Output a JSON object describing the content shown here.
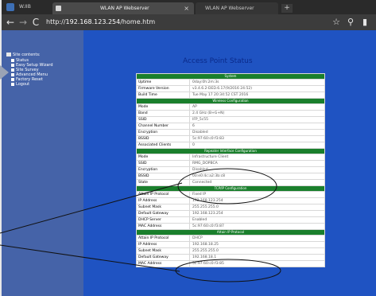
{
  "browser": {
    "app_name": "W.IIB",
    "tabs": [
      {
        "title": "WLAN AP Webserver",
        "active": true
      },
      {
        "title": "WLAN AP Webserver",
        "active": false
      }
    ],
    "url_prefix": "http://",
    "url_host": "192.168.123.254",
    "url_path": "/home.htm",
    "icons": [
      "back-icon",
      "forward-icon",
      "reload-icon",
      "star-icon",
      "search-icon",
      "bookmark-icon",
      "close-icon",
      "new-tab-icon"
    ]
  },
  "sidebar": {
    "title": "Site contents:",
    "items": [
      {
        "label": "Status"
      },
      {
        "label": "Easy Setup Wizard"
      },
      {
        "label": "Site Survey"
      },
      {
        "label": "Advanced Menu"
      },
      {
        "label": "Factory Reset"
      },
      {
        "label": "Logout"
      }
    ]
  },
  "main": {
    "heading": "Access Point Status",
    "sections": [
      {
        "title": "System",
        "rows": [
          {
            "key": "Uptime",
            "value": "0day:0h:2m:3s"
          },
          {
            "key": "Firmware Version",
            "value": "v3.4.6.2-DED.6.17(9/2016 24:52)"
          },
          {
            "key": "Build Time",
            "value": "Tue May 17 20:34:52 CST 2016"
          }
        ]
      },
      {
        "title": "Wireless Configuration",
        "rows": [
          {
            "key": "Mode",
            "value": "AP"
          },
          {
            "key": "Band",
            "value": "2.4 GHz (B+G+N)"
          },
          {
            "key": "SSID",
            "value": "IFP_5c55"
          },
          {
            "key": "Channel Number",
            "value": "6"
          },
          {
            "key": "Encryption",
            "value": "Disabled"
          },
          {
            "key": "BSSID",
            "value": "5c:97:60:c0:f3:83"
          },
          {
            "key": "Associated Clients",
            "value": "0"
          }
        ]
      },
      {
        "title": "Repeater Interface Configuration",
        "rows": [
          {
            "key": "Mode",
            "value": "Infrastructure Client"
          },
          {
            "key": "SSID",
            "value": "RMG_DOPBCA"
          },
          {
            "key": "Encryption",
            "value": "Disabled"
          },
          {
            "key": "BSSID",
            "value": "00:e0:4c:a2:3b:c8"
          },
          {
            "key": "State",
            "value": "Connected"
          }
        ]
      },
      {
        "title": "TCP/IP Configuration",
        "rows": [
          {
            "key": "Attain IP Protocol",
            "value": "Fixed IP"
          },
          {
            "key": "IP Address",
            "value": "192.168.123.254"
          },
          {
            "key": "Subnet Mask",
            "value": "255.255.255.0"
          },
          {
            "key": "Default Gateway",
            "value": "192.168.123.254"
          },
          {
            "key": "DHCP Server",
            "value": "Enabled"
          },
          {
            "key": "MAC Address",
            "value": "5c:97:60:c0:f3:87"
          }
        ]
      },
      {
        "title": "Attain IP Protocol",
        "rows": [
          {
            "key": "Attain IP Protocol",
            "value": "DHCP"
          },
          {
            "key": "IP Address",
            "value": "192.168.18.25"
          },
          {
            "key": "Subnet Mask",
            "value": "255.255.255.0"
          },
          {
            "key": "Default Gateway",
            "value": "192.168.18.1"
          },
          {
            "key": "MAC Address",
            "value": "5c:97:60:c0:f3:85"
          }
        ]
      }
    ]
  },
  "colors": {
    "page_bg": "#1f53c2",
    "sidebar_bg": "#4563a8",
    "section_header": "#1a7f2c",
    "heading": "#0a2a8a",
    "annotation": "#111111"
  }
}
